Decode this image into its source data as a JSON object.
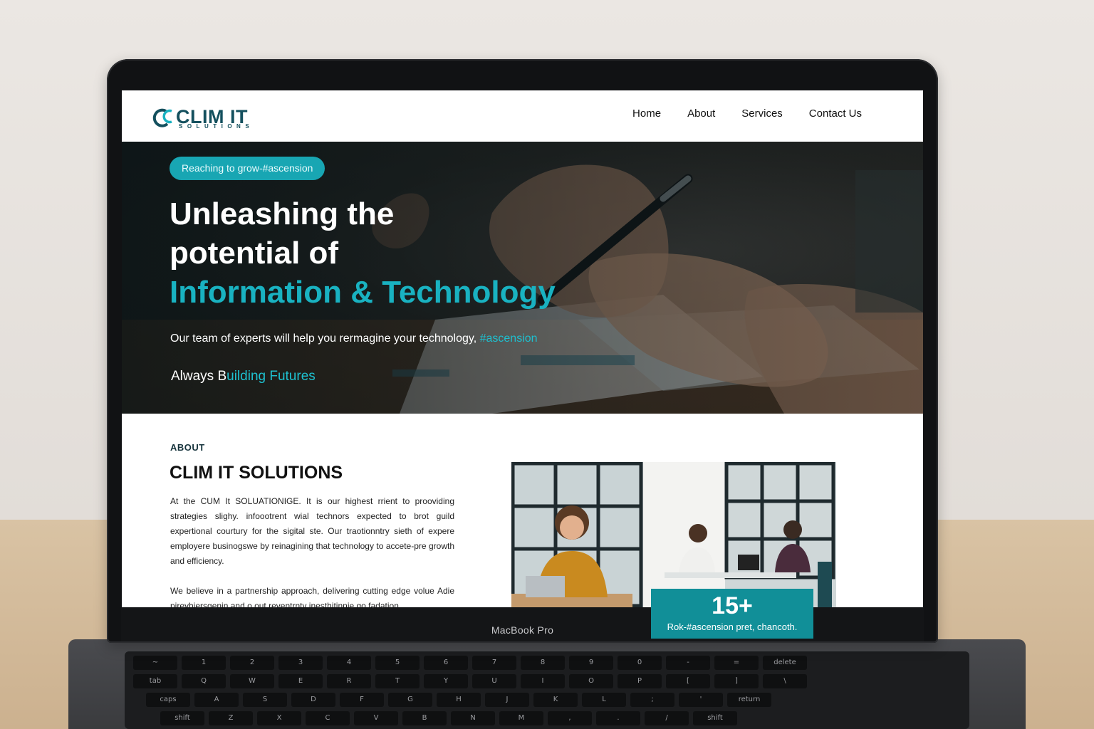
{
  "device": {
    "label": "MacBook Pro"
  },
  "site": {
    "logo": {
      "name": "CLIM IT",
      "sub": "SOLUTIONS"
    },
    "nav": [
      "Home",
      "About",
      "Services",
      "Contact Us"
    ]
  },
  "hero": {
    "badge": "Reaching to grow-#ascension",
    "title_line1": "Unleashing the",
    "title_line2": "potential of",
    "title_accent": "Information & Technology",
    "subtitle": "Our team of experts will help you rermagine your technology,",
    "subtitle_accent": "#ascension",
    "tagline_prefix": "Always B",
    "tagline_accent": "uilding Futures"
  },
  "about": {
    "kicker": "ABOUT",
    "title": "CLIM IT SOLUTIONS",
    "paragraph1": "At the CUM It SOLUATIONIGE. It is our highest rrient to prooviding strategies slighy. infoootrent wial technors expected to brot guild expertional courtury for the sigital ste. Our traotionntry sieth of expere employere businogswe by reinagining that technology to accete-pre growth and efficiency.",
    "paragraph2": "We believe in a partnership approach, delivering cutting edge volue Adie pireyhiersgenin and o out reventrnty inesthitinnie go fadation",
    "stat_number": "15+",
    "stat_label": "Rok-#ascension pret, chancoth."
  },
  "keyboard": {
    "row1": [
      "~",
      "1",
      "2",
      "3",
      "4",
      "5",
      "6",
      "7",
      "8",
      "9",
      "0",
      "-",
      "=",
      "delete"
    ],
    "row2": [
      "tab",
      "Q",
      "W",
      "E",
      "R",
      "T",
      "Y",
      "U",
      "I",
      "O",
      "P",
      "[",
      "]",
      "\\"
    ],
    "row3": [
      "caps",
      "A",
      "S",
      "D",
      "F",
      "G",
      "H",
      "J",
      "K",
      "L",
      ";",
      "'",
      "return"
    ],
    "row4": [
      "shift",
      "Z",
      "X",
      "C",
      "V",
      "B",
      "N",
      "M",
      ",",
      ".",
      "/",
      "shift"
    ]
  },
  "colors": {
    "accent": "#19b2c1",
    "brand": "#14505e",
    "stat_bg": "#118f98"
  }
}
